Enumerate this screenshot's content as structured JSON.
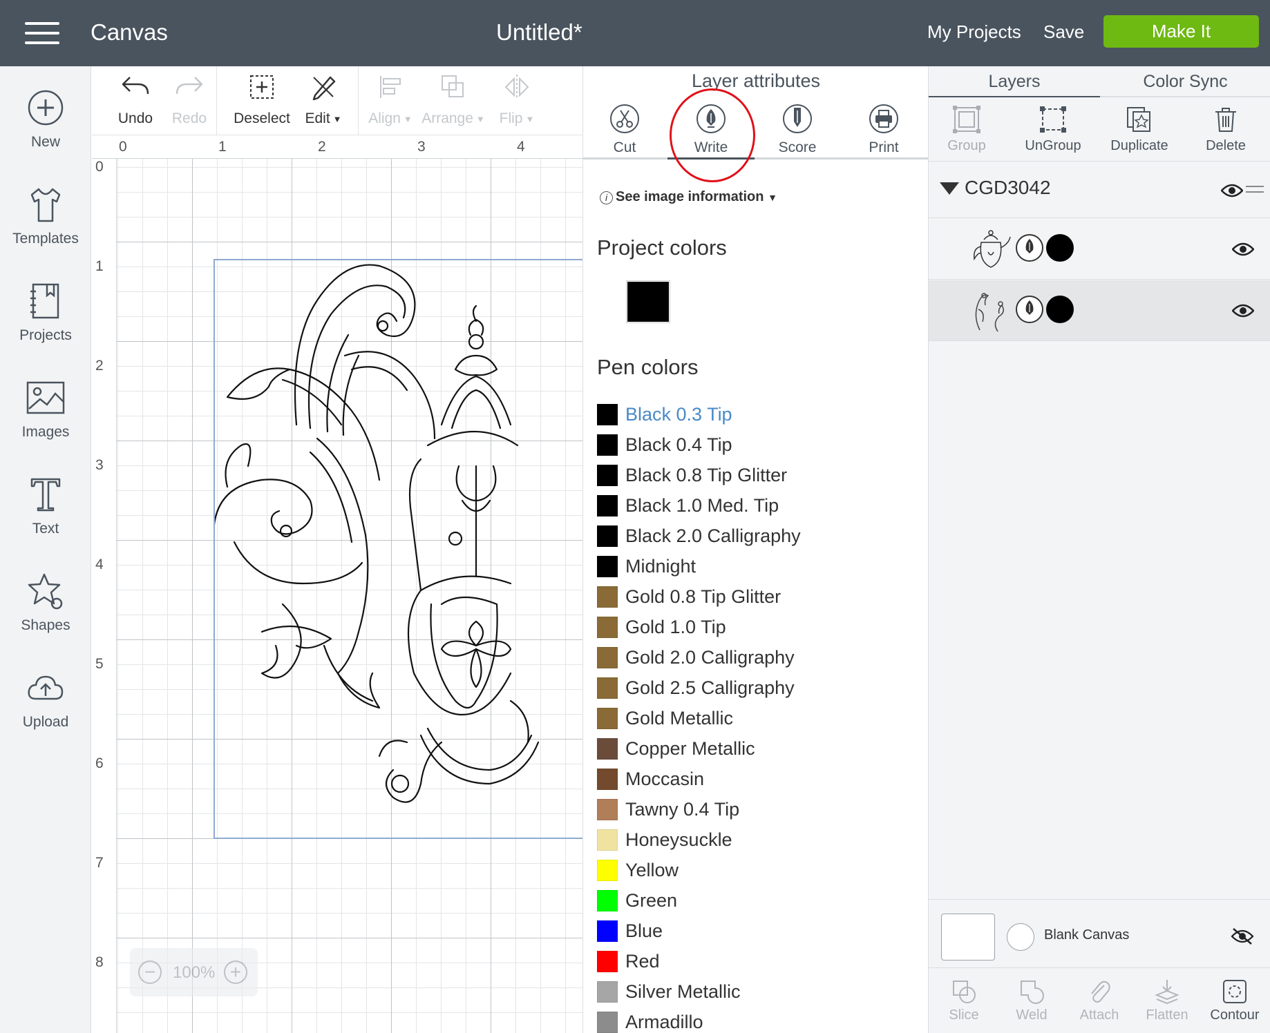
{
  "topbar": {
    "app_name": "Canvas",
    "doc_title": "Untitled*",
    "my_projects": "My Projects",
    "save": "Save",
    "make_it": "Make It"
  },
  "leftnav": {
    "items": [
      {
        "label": "New",
        "icon": "plus-circle-icon"
      },
      {
        "label": "Templates",
        "icon": "tshirt-icon"
      },
      {
        "label": "Projects",
        "icon": "notebook-icon"
      },
      {
        "label": "Images",
        "icon": "image-icon"
      },
      {
        "label": "Text",
        "icon": "text-t-icon"
      },
      {
        "label": "Shapes",
        "icon": "star-shape-icon"
      },
      {
        "label": "Upload",
        "icon": "cloud-upload-icon"
      }
    ]
  },
  "toolbar": {
    "undo": "Undo",
    "redo": "Redo",
    "deselect": "Deselect",
    "edit": "Edit",
    "align": "Align",
    "arrange": "Arrange",
    "flip": "Flip"
  },
  "canvas": {
    "ruler_x": [
      "0",
      "1",
      "2",
      "3",
      "4"
    ],
    "ruler_y": [
      "0",
      "1",
      "2",
      "3",
      "4",
      "5",
      "6",
      "7",
      "8"
    ],
    "zoom_level": "100%",
    "zoom_out": "−",
    "zoom_in": "+"
  },
  "attributes": {
    "title": "Layer attributes",
    "tabs": [
      "Cut",
      "Write",
      "Score",
      "Print"
    ],
    "active_tab": "Write",
    "image_info": "See image information",
    "project_colors_title": "Project colors",
    "project_colors": [
      "#000000"
    ],
    "pen_colors_title": "Pen colors",
    "pen_colors": [
      {
        "name": "Black 0.3 Tip",
        "color": "#000000",
        "selected": true
      },
      {
        "name": "Black 0.4 Tip",
        "color": "#000000"
      },
      {
        "name": "Black 0.8 Tip Glitter",
        "color": "#000000"
      },
      {
        "name": "Black 1.0 Med. Tip",
        "color": "#000000"
      },
      {
        "name": "Black 2.0 Calligraphy",
        "color": "#000000"
      },
      {
        "name": "Midnight",
        "color": "#000000"
      },
      {
        "name": "Gold 0.8 Tip Glitter",
        "color": "#8a6b37"
      },
      {
        "name": "Gold 1.0 Tip",
        "color": "#8a6b37"
      },
      {
        "name": "Gold 2.0 Calligraphy",
        "color": "#8a6b37"
      },
      {
        "name": "Gold 2.5 Calligraphy",
        "color": "#8a6b37"
      },
      {
        "name": "Gold Metallic",
        "color": "#8a6b37"
      },
      {
        "name": "Copper Metallic",
        "color": "#6b4c3b"
      },
      {
        "name": "Moccasin",
        "color": "#734a2e"
      },
      {
        "name": "Tawny 0.4 Tip",
        "color": "#b07e59"
      },
      {
        "name": "Honeysuckle",
        "color": "#f0e2a0"
      },
      {
        "name": "Yellow",
        "color": "#ffff00"
      },
      {
        "name": "Green",
        "color": "#00ff00"
      },
      {
        "name": "Blue",
        "color": "#0000ff"
      },
      {
        "name": "Red",
        "color": "#ff0000"
      },
      {
        "name": "Silver Metallic",
        "color": "#a6a6a6"
      },
      {
        "name": "Armadillo",
        "color": "#8c8c8c"
      }
    ]
  },
  "layers_panel": {
    "tabs": [
      "Layers",
      "Color Sync"
    ],
    "actions": [
      {
        "label": "Group",
        "enabled": false,
        "icon": "group-icon"
      },
      {
        "label": "UnGroup",
        "enabled": true,
        "icon": "ungroup-icon"
      },
      {
        "label": "Duplicate",
        "enabled": true,
        "icon": "duplicate-icon"
      },
      {
        "label": "Delete",
        "enabled": true,
        "icon": "trash-icon"
      }
    ],
    "group_name": "CGD3042",
    "layers": [
      {
        "thumbnail": "teapot-thumbnail",
        "pen_color": "#000000",
        "selected": false
      },
      {
        "thumbnail": "flourish-thumbnail",
        "pen_color": "#000000",
        "selected": true
      }
    ],
    "blank_canvas": "Blank Canvas",
    "bottom_actions": [
      {
        "label": "Slice",
        "enabled": false,
        "icon": "slice-icon"
      },
      {
        "label": "Weld",
        "enabled": false,
        "icon": "weld-icon"
      },
      {
        "label": "Attach",
        "enabled": false,
        "icon": "paperclip-icon"
      },
      {
        "label": "Flatten",
        "enabled": false,
        "icon": "flatten-icon"
      },
      {
        "label": "Contour",
        "enabled": true,
        "icon": "contour-icon"
      }
    ]
  },
  "colors": {
    "topbar": "#4a545e",
    "make_it": "#6fb913",
    "selected_pen": "#4a89c7",
    "annotation": "#e0111a"
  }
}
